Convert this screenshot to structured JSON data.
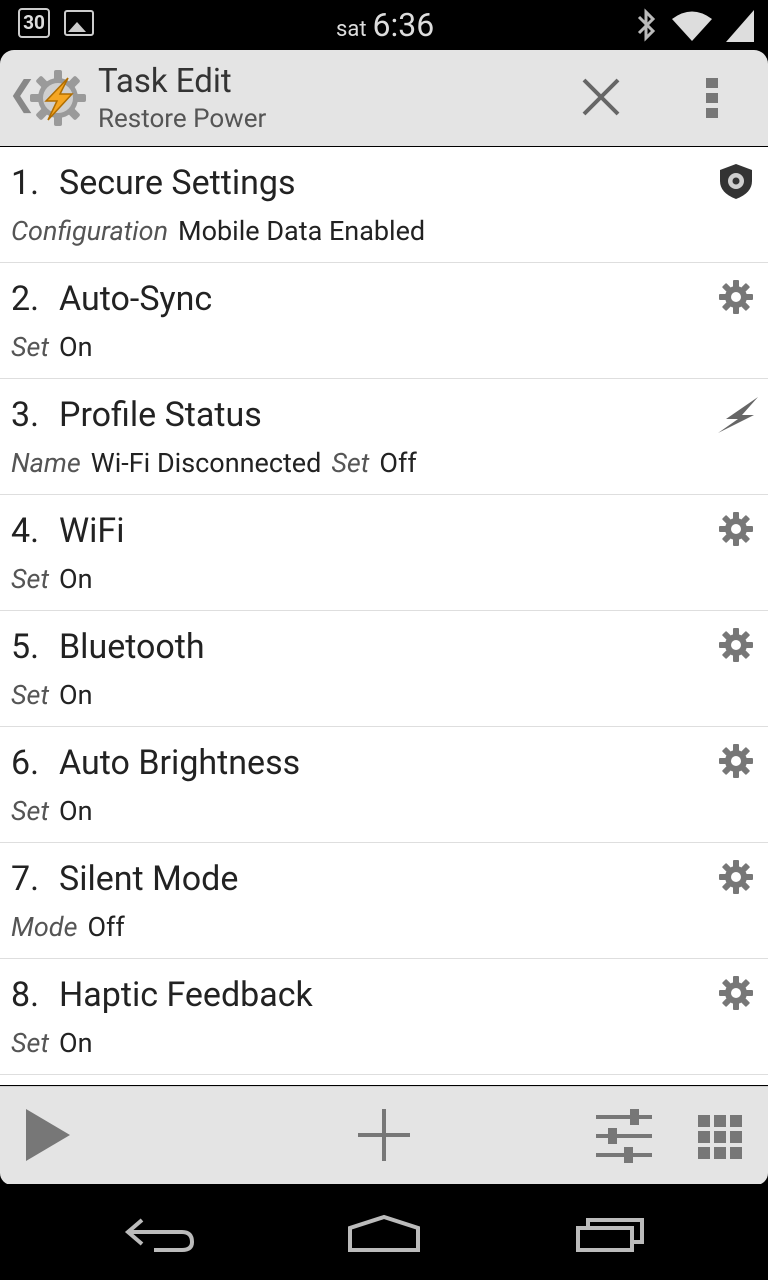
{
  "status_bar": {
    "notif_calendar": "30",
    "day": "sat",
    "time": "6:36",
    "icons": [
      "calendar-icon",
      "image-icon",
      "bluetooth-icon",
      "wifi-icon",
      "signal-icon"
    ]
  },
  "header": {
    "title": "Task Edit",
    "subtitle": "Restore Power",
    "icons": [
      "back-chevron-icon",
      "tasker-app-icon",
      "close-icon",
      "overflow-menu-icon"
    ]
  },
  "actions": [
    {
      "number": "1.",
      "name": "Secure Settings",
      "icon": "shield-gear-icon",
      "args": [
        {
          "key": "Configuration",
          "value": "Mobile Data Enabled"
        }
      ]
    },
    {
      "number": "2.",
      "name": "Auto-Sync",
      "icon": "gear-icon",
      "args": [
        {
          "key": "Set",
          "value": "On"
        }
      ]
    },
    {
      "number": "3.",
      "name": "Profile Status",
      "icon": "lightning-icon",
      "args": [
        {
          "key": "Name",
          "value": "Wi-Fi Disconnected"
        },
        {
          "key": "Set",
          "value": "Off"
        }
      ]
    },
    {
      "number": "4.",
      "name": "WiFi",
      "icon": "gear-icon",
      "args": [
        {
          "key": "Set",
          "value": "On"
        }
      ]
    },
    {
      "number": "5.",
      "name": "Bluetooth",
      "icon": "gear-icon",
      "args": [
        {
          "key": "Set",
          "value": "On"
        }
      ]
    },
    {
      "number": "6.",
      "name": "Auto Brightness",
      "icon": "gear-icon",
      "args": [
        {
          "key": "Set",
          "value": "On"
        }
      ]
    },
    {
      "number": "7.",
      "name": "Silent Mode",
      "icon": "gear-icon",
      "args": [
        {
          "key": "Mode",
          "value": "Off"
        }
      ]
    },
    {
      "number": "8.",
      "name": "Haptic Feedback",
      "icon": "gear-icon",
      "args": [
        {
          "key": "Set",
          "value": "On"
        }
      ]
    }
  ],
  "toolbar": {
    "icons": [
      "play-icon",
      "add-icon",
      "sliders-icon",
      "grid-icon"
    ]
  },
  "nav_bar": {
    "icons": [
      "back-icon",
      "home-icon",
      "recents-icon"
    ]
  },
  "colors": {
    "accent_orange": "#f5a623",
    "bar_bg": "#e4e4e4",
    "list_bg": "#ffffff",
    "icon_grey": "#777777"
  }
}
